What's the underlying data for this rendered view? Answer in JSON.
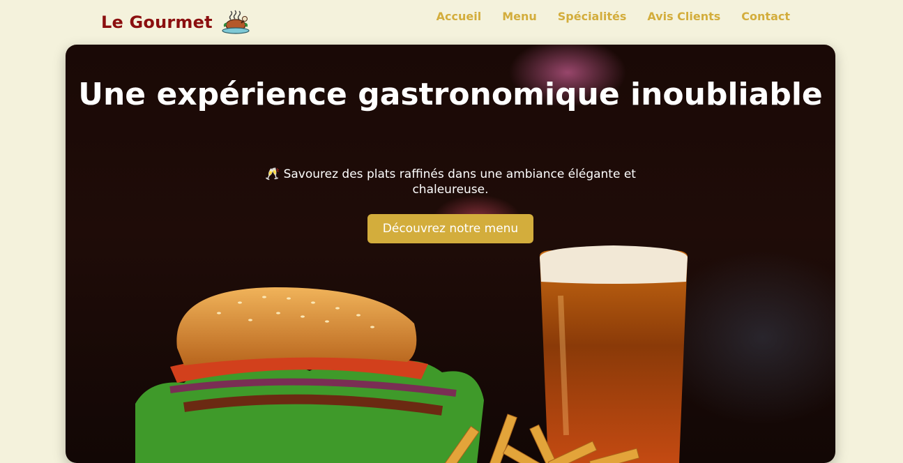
{
  "brand": {
    "name": "Le Gourmet",
    "icon": "roast-chicken-icon"
  },
  "nav": {
    "items": [
      "Accueil",
      "Menu",
      "Spécialités",
      "Avis Clients",
      "Contact"
    ]
  },
  "hero": {
    "title": "Une expérience gastronomique inoubliable",
    "subtitle": "🥂 Savourez des plats raffinés dans une ambiance élégante et chaleureuse.",
    "cta_label": "Découvrez notre menu"
  },
  "colors": {
    "background": "#f4f2dc",
    "brand": "#8b0f0f",
    "accent": "#d3ad3c",
    "hero_text": "#ffffff"
  }
}
